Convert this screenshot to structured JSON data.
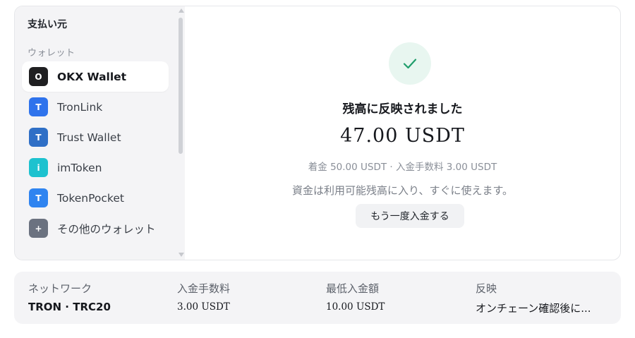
{
  "sidebar": {
    "title": "支払い元",
    "section_label": "ウォレット",
    "items": [
      {
        "label": "OKX Wallet",
        "icon_text": "O",
        "icon": "okx-icon",
        "color": "#1f1f21",
        "active": true
      },
      {
        "label": "TronLink",
        "icon_text": "T",
        "icon": "tronlink-icon",
        "color": "#2f73ec",
        "active": false
      },
      {
        "label": "Trust Wallet",
        "icon_text": "T",
        "icon": "trust-wallet-icon",
        "color": "#2f6fc6",
        "active": false
      },
      {
        "label": "imToken",
        "icon_text": "i",
        "icon": "imtoken-icon",
        "color": "#1dc2cf",
        "active": false
      },
      {
        "label": "TokenPocket",
        "icon_text": "T",
        "icon": "tokenpocket-icon",
        "color": "#2f84f0",
        "active": false
      },
      {
        "label": "その他のウォレット",
        "icon_text": "+",
        "icon": "plus-icon",
        "color": "#6b7280",
        "active": false
      }
    ]
  },
  "result": {
    "icon": "check-icon",
    "check_color": "#1f9d6b",
    "title": "残高に反映されました",
    "amount": "47.00 USDT",
    "detail": "着金 50.00 USDT · 入金手数料 3.00 USDT",
    "note": "資金は利用可能残高に入り、すぐに使えます。",
    "again_button": "もう一度入金する"
  },
  "info": {
    "network_label": "ネットワーク",
    "network_value": "TRON · TRC20",
    "fee_label": "入金手数料",
    "fee_value": "3.00 USDT",
    "min_label": "最低入金額",
    "min_value": "10.00 USDT",
    "reflect_label": "反映",
    "reflect_value": "オンチェーン確認後に..."
  }
}
